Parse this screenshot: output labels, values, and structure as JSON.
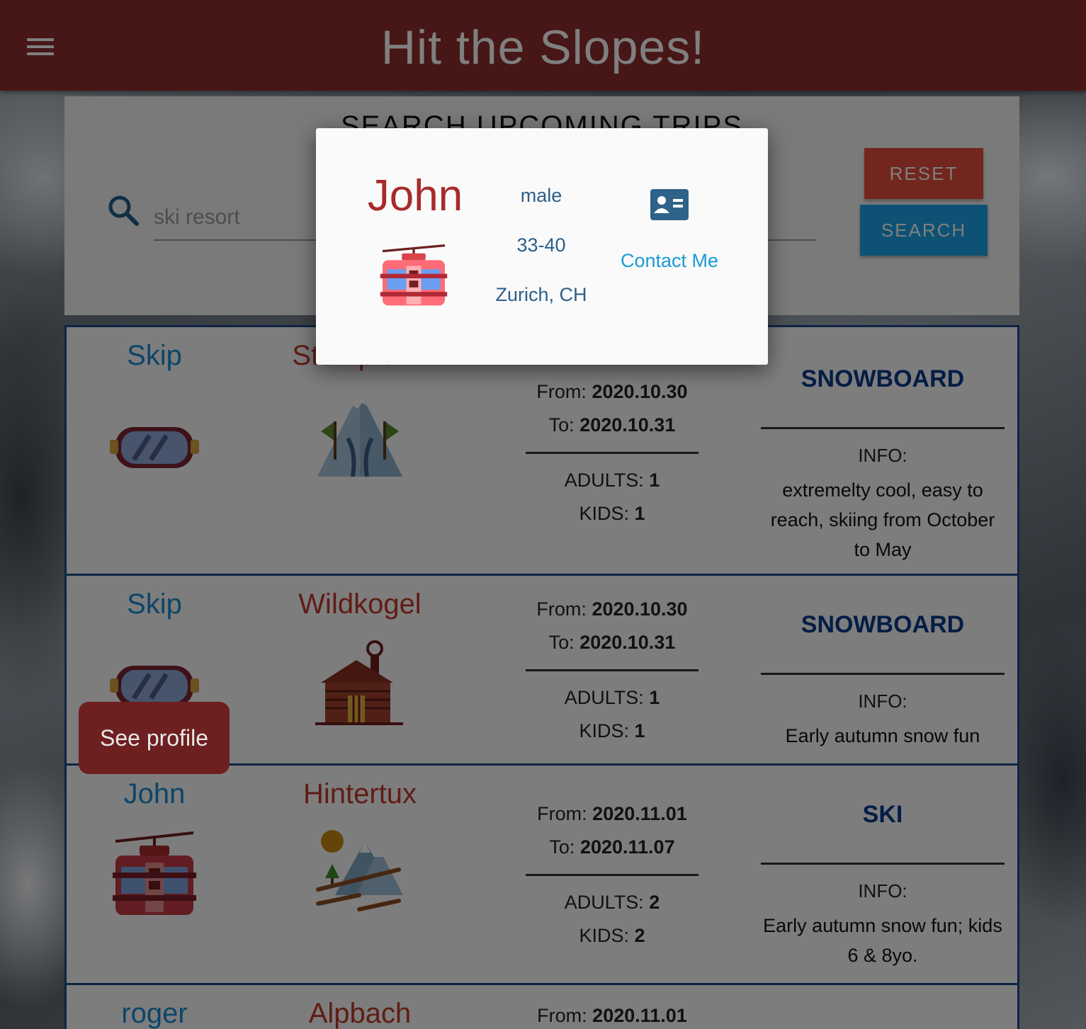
{
  "app": {
    "title": "Hit the Slopes!"
  },
  "search": {
    "heading": "SEARCH UPCOMING TRIPS",
    "placeholder": "ski resort",
    "reset_label": "RESET",
    "search_label": "SEARCH"
  },
  "labels": {
    "from": "From:",
    "to": "To:",
    "adults": "ADULTS:",
    "kids": "KIDS:",
    "info": "INFO:"
  },
  "trips": [
    {
      "user": "Skip",
      "user_icon": "ski-goggles-icon",
      "resort": "Stumpfalm",
      "resort_icon": "mountain-flags-icon",
      "from": "2020.10.30",
      "to": "2020.10.31",
      "adults": "1",
      "kids": "1",
      "type": "SNOWBOARD",
      "info": "extremelty cool, easy to reach, skiing from October to May"
    },
    {
      "user": "Skip",
      "user_icon": "ski-goggles-icon",
      "resort": "Wildkogel",
      "resort_icon": "log-cabin-icon",
      "from": "2020.10.30",
      "to": "2020.10.31",
      "adults": "1",
      "kids": "1",
      "type": "SNOWBOARD",
      "info": "Early autumn snow fun"
    },
    {
      "user": "John",
      "user_icon": "cable-car-icon",
      "resort": "Hintertux",
      "resort_icon": "mountain-landscape-icon",
      "from": "2020.11.01",
      "to": "2020.11.07",
      "adults": "2",
      "kids": "2",
      "type": "SKI",
      "info": "Early autumn snow fun; kids 6 & 8yo."
    },
    {
      "user": "roger",
      "resort": "Alpbach",
      "from": "2020.11.01"
    }
  ],
  "tooltip": {
    "label": "See profile"
  },
  "profile_modal": {
    "name": "John",
    "icon": "cable-car-icon",
    "gender": "male",
    "age_range": "33-40",
    "location": "Zurich, CH",
    "contact_icon": "contact-card-icon",
    "contact_label": "Contact Me"
  },
  "colors": {
    "header": "#8f2d2d",
    "reset": "#e74c3c",
    "search": "#1aa4e8",
    "user_name": "#1a8ad0",
    "resort_name": "#c0392b",
    "trip_type": "#0b3a8a"
  }
}
